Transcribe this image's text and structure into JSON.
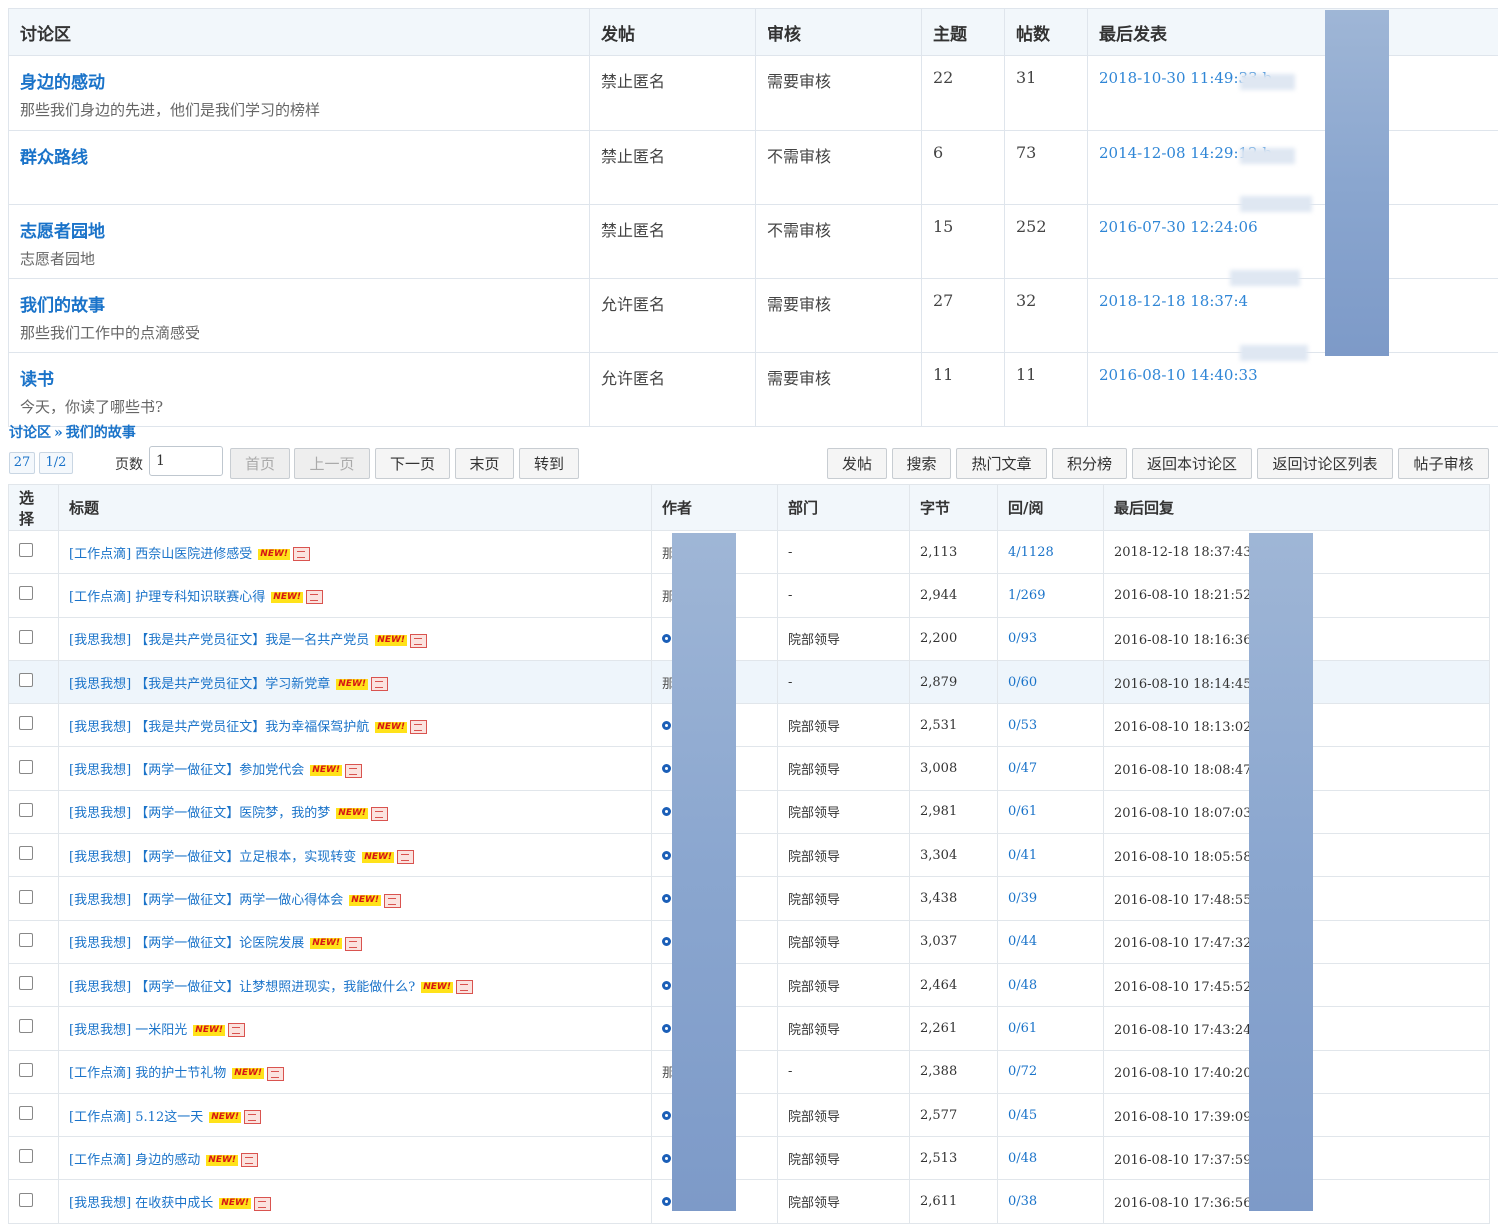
{
  "forum": {
    "headers": {
      "name": "讨论区",
      "post": "发帖",
      "review": "审核",
      "topics": "主题",
      "posts": "帖数",
      "last": "最后发表"
    },
    "rows": [
      {
        "name": "身边的感动",
        "desc": "那些我们身边的先进，他们是我们学习的榜样",
        "post": "禁止匿名",
        "review": "需要审核",
        "topics": "22",
        "posts": "31",
        "last": "2018-10-30 11:49:33 b"
      },
      {
        "name": "群众路线",
        "desc": "",
        "post": "禁止匿名",
        "review": "不需审核",
        "topics": "6",
        "posts": "73",
        "last": "2014-12-08 14:29:12 b"
      },
      {
        "name": "志愿者园地",
        "desc": "志愿者园地",
        "post": "禁止匿名",
        "review": "不需审核",
        "topics": "15",
        "posts": "252",
        "last": "2016-07-30 12:24:06 "
      },
      {
        "name": "我们的故事",
        "desc": "那些我们工作中的点滴感受",
        "post": "允许匿名",
        "review": "需要审核",
        "topics": "27",
        "posts": "32",
        "last": "2018-12-18 18:37:4"
      },
      {
        "name": "读书",
        "desc": "今天，你读了哪些书?",
        "post": "允许匿名",
        "review": "需要审核",
        "topics": "11",
        "posts": "11",
        "last": "2016-08-10 14:40:33 "
      }
    ]
  },
  "breadcrumb": {
    "root": "讨论区",
    "sep": "»",
    "current": "我们的故事"
  },
  "pager": {
    "total": "27",
    "pages": "1/2",
    "page_label": "页数",
    "page_value": "1",
    "first": "首页",
    "prev": "上一页",
    "next": "下一页",
    "last": "末页",
    "goto": "转到"
  },
  "toolbar": {
    "post": "发帖",
    "search": "搜索",
    "hot": "热门文章",
    "rank": "积分榜",
    "back_board": "返回本讨论区",
    "back_list": "返回讨论区列表",
    "audit": "帖子审核"
  },
  "posts": {
    "headers": {
      "select": "选择",
      "title": "标题",
      "author": "作者",
      "dept": "部门",
      "bytes": "字节",
      "rr": "回/阅",
      "lastreply": "最后回复"
    },
    "new_label": "NEW!",
    "rows": [
      {
        "title": "[工作点滴] 西奈山医院进修感受",
        "author": "那",
        "dept": "-",
        "bytes": "2,113",
        "rr": "4/1128",
        "last": "2018-12-18 18:37:43 by"
      },
      {
        "title": "[工作点滴] 护理专科知识联赛心得",
        "author": "那",
        "dept": "-",
        "bytes": "2,944",
        "rr": "1/269",
        "last": "2016-08-10 18:21:52 by"
      },
      {
        "title": "[我思我想] 【我是共产党员征文】我是一名共产党员",
        "author": "",
        "dept": "院部领导",
        "bytes": "2,200",
        "rr": "0/93",
        "last": "2016-08-10 18:16:36 by 孙"
      },
      {
        "title": "[我思我想] 【我是共产党员征文】学习新党章",
        "author": "那",
        "dept": "-",
        "bytes": "2,879",
        "rr": "0/60",
        "last": "2016-08-10 18:14:45 by 那"
      },
      {
        "title": "[我思我想] 【我是共产党员征文】我为幸福保驾护航",
        "author": "",
        "dept": "院部领导",
        "bytes": "2,531",
        "rr": "0/53",
        "last": "2016-08-10 18:13:02 by 孙"
      },
      {
        "title": "[我思我想] 【两学一做征文】参加党代会",
        "author": "",
        "dept": "院部领导",
        "bytes": "3,008",
        "rr": "0/47",
        "last": "2016-08-10 18:08:47 by 孙"
      },
      {
        "title": "[我思我想] 【两学一做征文】医院梦，我的梦",
        "author": "",
        "dept": "院部领导",
        "bytes": "2,981",
        "rr": "0/61",
        "last": "2016-08-10 18:07:03 by 孙"
      },
      {
        "title": "[我思我想] 【两学一做征文】立足根本，实现转变",
        "author": "",
        "dept": "院部领导",
        "bytes": "3,304",
        "rr": "0/41",
        "last": "2016-08-10 18:05:58 by 孙"
      },
      {
        "title": "[我思我想] 【两学一做征文】两学一做心得体会",
        "author": "",
        "dept": "院部领导",
        "bytes": "3,438",
        "rr": "0/39",
        "last": "2016-08-10 17:48:55 by 孙"
      },
      {
        "title": "[我思我想] 【两学一做征文】论医院发展",
        "author": "",
        "dept": "院部领导",
        "bytes": "3,037",
        "rr": "0/44",
        "last": "2016-08-10 17:47:32 by 孙"
      },
      {
        "title": "[我思我想] 【两学一做征文】让梦想照进现实，我能做什么?",
        "author": "",
        "dept": "院部领导",
        "bytes": "2,464",
        "rr": "0/48",
        "last": "2016-08-10 17:45:52 by 孙"
      },
      {
        "title": "[我思我想] 一米阳光",
        "author": "",
        "dept": "院部领导",
        "bytes": "2,261",
        "rr": "0/61",
        "last": "2016-08-10 17:43:24 by 孙"
      },
      {
        "title": "[工作点滴] 我的护士节礼物",
        "author": "那",
        "dept": "-",
        "bytes": "2,388",
        "rr": "0/72",
        "last": "2016-08-10 17:40:20 by 那"
      },
      {
        "title": "[工作点滴] 5.12这一天",
        "author": "",
        "dept": "院部领导",
        "bytes": "2,577",
        "rr": "0/45",
        "last": "2016-08-10 17:39:09 by 孙"
      },
      {
        "title": "[工作点滴] 身边的感动",
        "author": "",
        "dept": "院部领导",
        "bytes": "2,513",
        "rr": "0/48",
        "last": "2016-08-10 17:37:59 by 孙"
      },
      {
        "title": "[我思我想] 在收获中成长",
        "author": "",
        "dept": "院部领导",
        "bytes": "2,611",
        "rr": "0/38",
        "last": "2016-08-10 17:36:56 by 孙"
      }
    ]
  }
}
